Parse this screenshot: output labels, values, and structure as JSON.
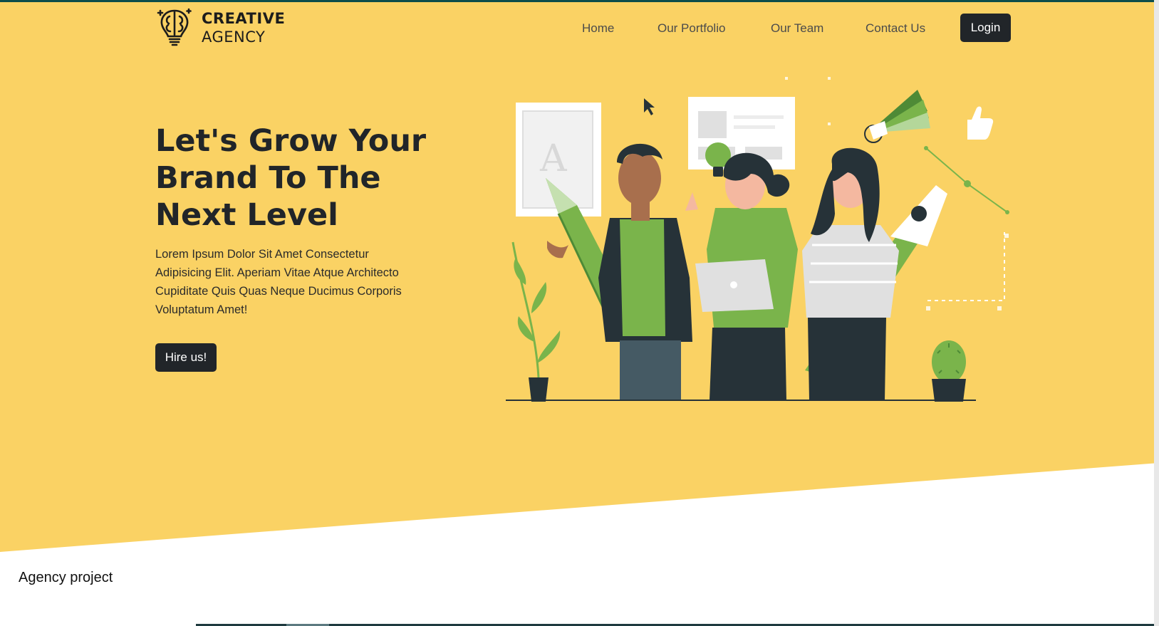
{
  "brand": {
    "line1": "CREATIVE",
    "line2": "AGENCY",
    "logo_icon": "brain-bulb-icon"
  },
  "nav": {
    "items": [
      {
        "label": "Home"
      },
      {
        "label": "Our Portfolio"
      },
      {
        "label": "Our Team"
      },
      {
        "label": "Contact Us"
      }
    ],
    "login_label": "Login"
  },
  "hero": {
    "title": "Let's Grow Your Brand To The Next Level",
    "description": "Lorem Ipsum Dolor Sit Amet Consectetur Adipisicing Elit. Aperiam Vitae Atque Architecto Cupiditate Quis Quas Neque Ducimus Corporis Voluptatum Amet!",
    "cta_label": "Hire us!",
    "illustration_letter": "A"
  },
  "footer": {
    "text": "Agency project"
  },
  "colors": {
    "hero_bg": "#fad264",
    "dark": "#212529",
    "accent_green": "#7ab44b",
    "top_border": "#0d4d4a"
  }
}
